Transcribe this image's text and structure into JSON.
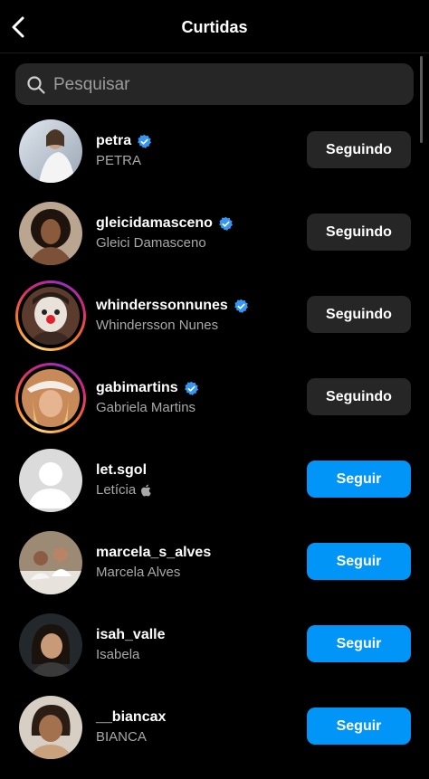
{
  "header": {
    "title": "Curtidas"
  },
  "search": {
    "placeholder": "Pesquisar"
  },
  "accent_color": "#0095f6",
  "users": [
    {
      "username": "petra",
      "full_name": "PETRA",
      "verified": true,
      "button": "Seguindo"
    },
    {
      "username": "gleicidamasceno",
      "full_name": "Gleici Damasceno",
      "verified": true,
      "button": "Seguindo"
    },
    {
      "username": "whinderssonnunes",
      "full_name": "Whindersson Nunes",
      "verified": true,
      "button": "Seguindo"
    },
    {
      "username": "gabimartins",
      "full_name": "Gabriela Martins",
      "verified": true,
      "button": "Seguindo"
    },
    {
      "username": "let.sgol",
      "full_name": "Letícia",
      "verified": false,
      "button": "Seguir"
    },
    {
      "username": "marcela_s_alves",
      "full_name": "Marcela Alves",
      "verified": false,
      "button": "Seguir"
    },
    {
      "username": "isah_valle",
      "full_name": "Isabela",
      "verified": false,
      "button": "Seguir"
    },
    {
      "username": "__biancax",
      "full_name": "BIANCA",
      "verified": false,
      "button": "Seguir"
    }
  ]
}
